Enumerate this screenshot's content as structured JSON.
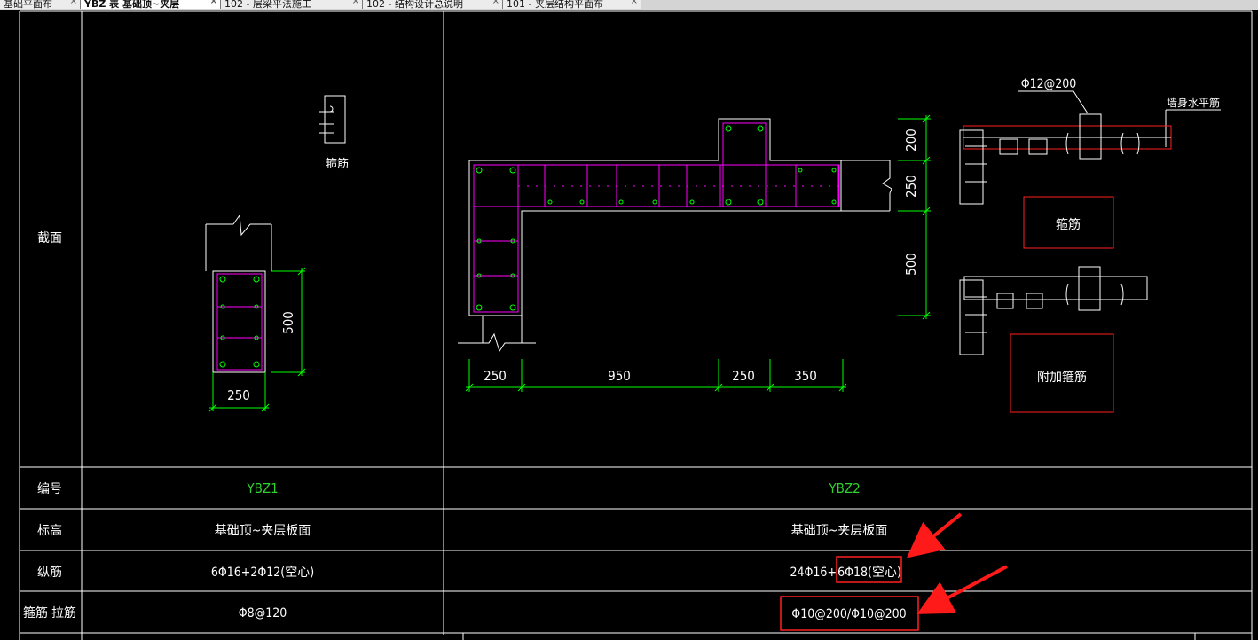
{
  "tabs": [
    {
      "label": "基础平面布",
      "active": false
    },
    {
      "label": "YBZ 表 基础顶~夹层",
      "active": true
    },
    {
      "label": "102 - 层梁平法施工",
      "active": false
    },
    {
      "label": "102 - 结构设计总说明",
      "active": false
    },
    {
      "label": "101 - 夹层结构平面布",
      "active": false
    }
  ],
  "table": {
    "header_section": "截面",
    "row_labels": {
      "id": "编号",
      "elevation": "标高",
      "longitudinal": "纵筋",
      "stirrup": "箍筋 拉筋"
    },
    "columns": [
      {
        "id": "YBZ1",
        "elevation": "基础顶~夹层板面",
        "longitudinal": "6Φ16+2Φ12(空心)",
        "stirrup": "Φ8@120"
      },
      {
        "id": "YBZ2",
        "elevation": "基础顶~夹层板面",
        "longitudinal_main": "24Φ16+",
        "longitudinal_highlight": "6Φ18(空心)",
        "stirrup": "Φ10@200/Φ10@200"
      }
    ]
  },
  "drawing": {
    "ybz1": {
      "stirrup_label": "箍筋",
      "dim_height": "500",
      "dim_width": "250"
    },
    "ybz2": {
      "dims_bottom": [
        "250",
        "950",
        "250",
        "350"
      ],
      "dims_right": [
        "200",
        "250",
        "500"
      ]
    },
    "legend": {
      "rebar_label": "Φ12@200",
      "wall_rebar_label": "墙身水平筋",
      "stirrup_box_label": "箍筋",
      "extra_stirrup_box_label": "附加箍筋"
    }
  },
  "colors": {
    "background": "#000000",
    "grid_line": "#ffffff",
    "rebar": "#ff00ff",
    "dimension": "#00ff00",
    "highlight": "#ff2020",
    "arrow": "#ff1a1a",
    "id_text": "#2fd12f"
  }
}
